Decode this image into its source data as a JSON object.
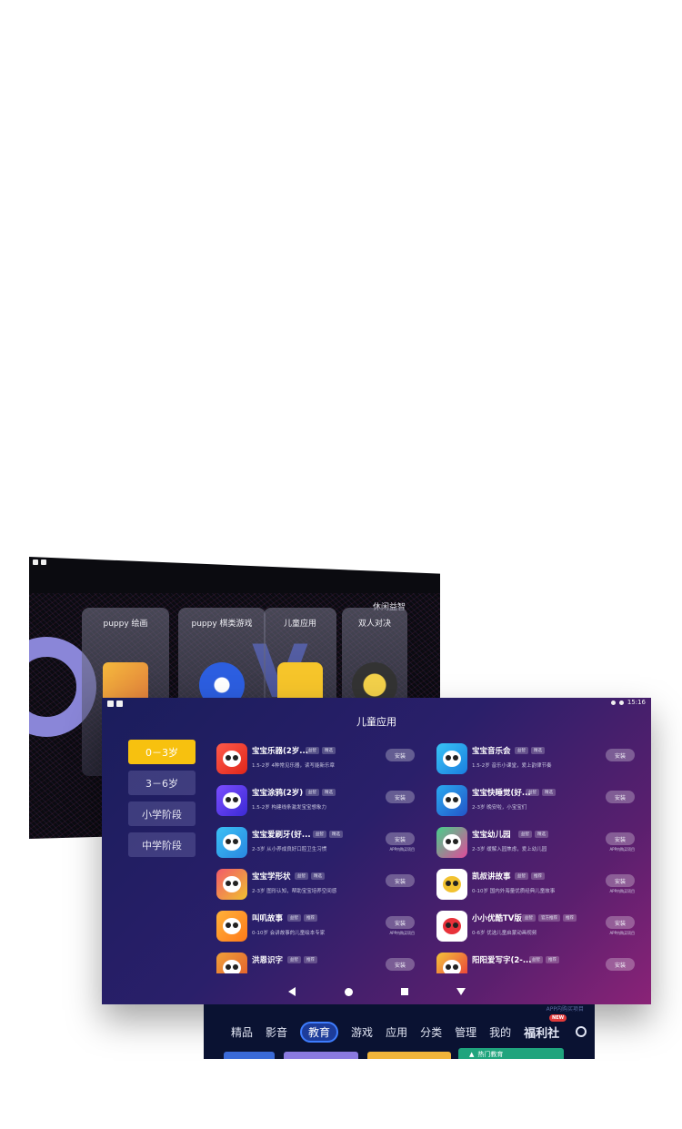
{
  "back_screen": {
    "header_label": "休闲益智",
    "cards": [
      {
        "title": "puppy 绘画",
        "icon": "drawing-board-icon"
      },
      {
        "title": "puppy 棋类游戏",
        "icon": "chess-board-icon"
      },
      {
        "title": "儿童应用",
        "icon": "shopping-bag-icon"
      },
      {
        "title": "双人对决",
        "icon": "vs-battle-icon"
      }
    ]
  },
  "front_screen": {
    "status_time": "15:16",
    "title": "儿童应用",
    "age_tabs": [
      {
        "label": "0－3岁",
        "active": true
      },
      {
        "label": "3－6岁",
        "active": false
      },
      {
        "label": "小学阶段",
        "active": false
      },
      {
        "label": "中学阶段",
        "active": false
      }
    ],
    "apps": [
      {
        "name": "宝宝乐器(2岁...",
        "tags": [
          "益智",
          "精选"
        ],
        "desc": "1.5-2岁 4种常见乐器，读写能新乐章",
        "install": "安装",
        "note": ""
      },
      {
        "name": "宝宝音乐会",
        "tags": [
          "益智",
          "精选"
        ],
        "desc": "1.5-2岁 音乐小课堂，爱上韵律节奏",
        "install": "安装",
        "note": ""
      },
      {
        "name": "宝宝涂鸦(2岁)",
        "tags": [
          "益智",
          "精选"
        ],
        "desc": "1.5-2岁 构建线条激发宝宝想象力",
        "install": "安装",
        "note": ""
      },
      {
        "name": "宝宝快睡觉(好...",
        "tags": [
          "益智",
          "精选"
        ],
        "desc": "2-3岁 晚安啦，小宝宝们",
        "install": "安装",
        "note": ""
      },
      {
        "name": "宝宝爱刷牙(好...",
        "tags": [
          "益智",
          "精选"
        ],
        "desc": "2-3岁 从小养成良好口腔卫生习惯",
        "install": "安装",
        "note": "APP内购买项目"
      },
      {
        "name": "宝宝幼儿园",
        "tags": [
          "益智",
          "精选"
        ],
        "desc": "2-3岁 缓解入园焦虑，爱上幼儿园",
        "install": "安装",
        "note": "APP内购买项目"
      },
      {
        "name": "宝宝学形状",
        "tags": [
          "益智",
          "精选"
        ],
        "desc": "2-3岁 图形认知，帮助宝宝培养空间感",
        "install": "安装",
        "note": ""
      },
      {
        "name": "凯叔讲故事",
        "tags": [
          "益智",
          "推荐"
        ],
        "desc": "0-10岁 国内外海量优质经典儿童故事",
        "install": "安装",
        "note": "APP内购买项目"
      },
      {
        "name": "叫叽故事",
        "tags": [
          "益智",
          "推荐"
        ],
        "desc": "0-10岁 会讲故事的儿童绘本专家",
        "install": "安装",
        "note": "APP内购买项目"
      },
      {
        "name": "小小优酷TV版",
        "tags": [
          "益智",
          "官方推荐",
          "推荐"
        ],
        "desc": "0-6岁 优选儿童启蒙动画视频",
        "install": "安装",
        "note": "APP内购买项目"
      },
      {
        "name": "洪恩识字",
        "tags": [
          "益智",
          "推荐"
        ],
        "desc": "",
        "install": "安装",
        "note": ""
      },
      {
        "name": "阳阳爱写字(2-...",
        "tags": [
          "益智",
          "推荐"
        ],
        "desc": "",
        "install": "安装",
        "note": ""
      }
    ]
  },
  "tv_strip": {
    "top_text": "APP内购买项目",
    "tabs": [
      {
        "label": "精品",
        "active": false
      },
      {
        "label": "影音",
        "active": false
      },
      {
        "label": "教育",
        "active": true
      },
      {
        "label": "游戏",
        "active": false
      },
      {
        "label": "应用",
        "active": false
      },
      {
        "label": "分类",
        "active": false
      },
      {
        "label": "管理",
        "active": false
      },
      {
        "label": "我的",
        "active": false
      }
    ],
    "special_tab": "福利社",
    "new_badge": "NEW",
    "hot_label": "热门教育"
  }
}
